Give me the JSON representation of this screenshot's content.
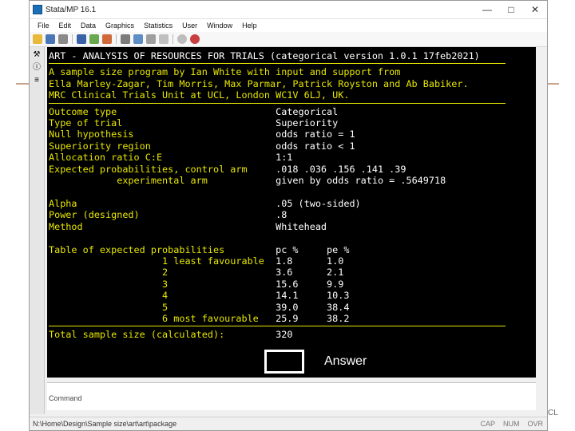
{
  "window": {
    "title": "Stata/MP 16.1"
  },
  "menu": [
    "File",
    "Edit",
    "Data",
    "Graphics",
    "Statistics",
    "User",
    "Window",
    "Help"
  ],
  "output": {
    "title_plain": "ART - ANALYSIS OF RESOURCES FOR TRIALS (categorical version 1.0.1 17feb2021)",
    "credits": [
      "A sample size program by Ian White with input and support from",
      "Ella Marley-Zagar, Tim Morris, Max Parmar, Patrick Royston and Ab Babiker.",
      "MRC Clinical Trials Unit at UCL, London WC1V 6LJ, UK."
    ],
    "rows": [
      {
        "label": "Outcome type",
        "value": "Categorical"
      },
      {
        "label": "Type of trial",
        "value": "Superiority"
      },
      {
        "label": "Null hypothesis",
        "value": "odds ratio = 1"
      },
      {
        "label": "Superiority region",
        "value": "odds ratio < 1"
      },
      {
        "label": "Allocation ratio C:E",
        "value": "1:1"
      },
      {
        "label": "Expected probabilities, control arm",
        "value": ".018 .036 .156 .141 .39"
      },
      {
        "label": "            experimental arm",
        "value": "given by odds ratio = .5649718"
      }
    ],
    "rows2": [
      {
        "label": "Alpha",
        "value": ".05 (two-sided)"
      },
      {
        "label": "Power (designed)",
        "value": ".8"
      },
      {
        "label": "Method",
        "value": "Whitehead"
      }
    ],
    "table": {
      "header_label": "Table of expected probabilities",
      "col1": "pc %",
      "col2": "pe %",
      "rows": [
        {
          "k": "1 least favourable",
          "pc": "1.8",
          "pe": "1.0"
        },
        {
          "k": "2",
          "pc": "3.6",
          "pe": "2.1"
        },
        {
          "k": "3",
          "pc": "15.6",
          "pe": "9.9"
        },
        {
          "k": "4",
          "pc": "14.1",
          "pe": "10.3"
        },
        {
          "k": "5",
          "pc": "39.0",
          "pe": "38.4"
        },
        {
          "k": "6 most favourable",
          "pc": "25.9",
          "pe": "38.2"
        }
      ]
    },
    "total_label": "Total sample size (calculated):",
    "total_value": "320"
  },
  "annotation": "Answer",
  "command_label": "Command",
  "status": {
    "path": "N:\\Home\\Design\\Sample size\\art\\art\\package",
    "indicators": [
      "CAP",
      "NUM",
      "OVR"
    ]
  },
  "ucl": "CL",
  "colors": {
    "output_text": "#e6e600",
    "output_bg": "#000000",
    "highlight": "#ffffff"
  }
}
